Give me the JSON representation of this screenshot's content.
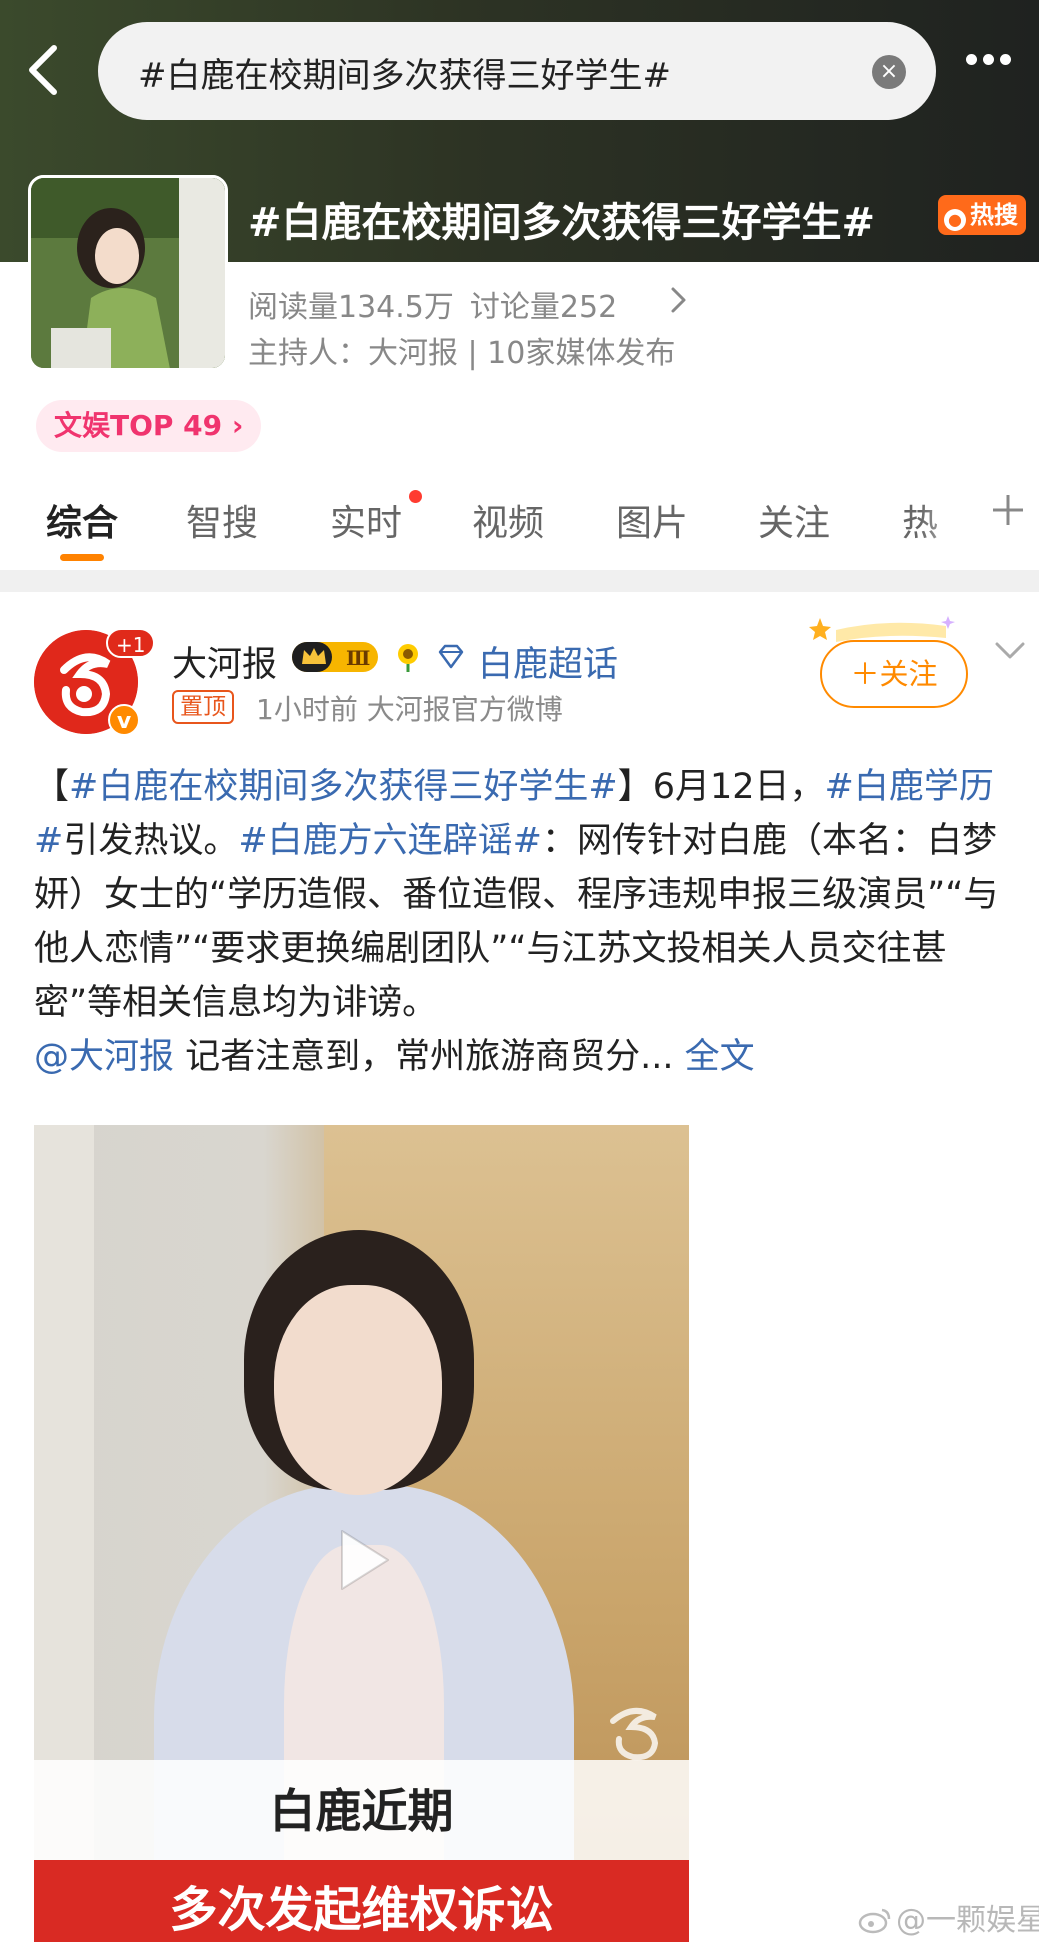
{
  "search": {
    "query": "#白鹿在校期间多次获得三好学生#",
    "clear_glyph": "×"
  },
  "topic": {
    "title": "#白鹿在校期间多次获得三好学生#",
    "hot_badge": "热搜",
    "reads": "阅读量134.5万",
    "discussions": "讨论量252",
    "host": "主持人：大河报 | 10家媒体发布",
    "rank": "文娱TOP 49 ›"
  },
  "tabs": [
    {
      "label": "综合",
      "active": true
    },
    {
      "label": "智搜"
    },
    {
      "label": "实时",
      "has_dot": true
    },
    {
      "label": "视频"
    },
    {
      "label": "图片"
    },
    {
      "label": "关注"
    },
    {
      "label": "热"
    }
  ],
  "post": {
    "author": "大河报",
    "avatar_badge": "+1",
    "verified_mark": "v",
    "level": "Ⅲ",
    "super_topic": "白鹿超话",
    "pin_tag": "置顶",
    "meta": "1小时前  大河报官方微博",
    "follow_label": "＋关注",
    "body": {
      "open_bracket": "【",
      "tag1": "#白鹿在校期间多次获得三好学生#",
      "close_bracket": "】",
      "date_text": "6月12日，",
      "tag2": "#白鹿学历#",
      "text1": "引发热议。",
      "tag3": "#白鹿方六连辟谣#",
      "text2": "：网传针对白鹿（本名：白梦妍）女士的“学历造假、番位造假、程序违规申报三级演员”“与他人恋情”“要求更换编剧团队”“与江苏文投相关人员交往甚密”等相关信息均为诽谤。",
      "mention": "@大河报",
      "text3": " 记者注意到，常州旅游商贸分... ",
      "full_text": "全文"
    },
    "video": {
      "caption_1": "白鹿近期",
      "caption_2": "多次发起维权诉讼"
    }
  },
  "watermark": "@一颗娱星",
  "colors": {
    "accent_orange": "#ff8200",
    "link_blue": "#3a6ab0",
    "hot_orange": "#ff6a1a",
    "rank_pink": "#f0346e"
  }
}
